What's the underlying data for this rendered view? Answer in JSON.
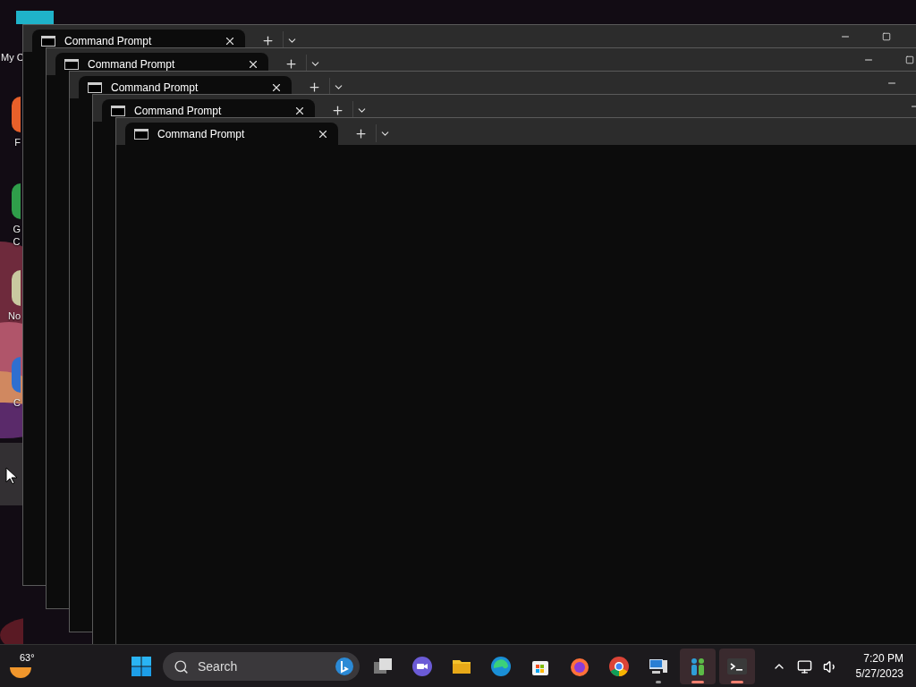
{
  "desktop": {
    "icons": [
      {
        "lines": [
          "My C"
        ],
        "kind": "folder"
      },
      {
        "lines": [
          "F"
        ],
        "kind": "firefox"
      },
      {
        "lines": [
          "G",
          "C"
        ],
        "kind": "chrome"
      },
      {
        "lines": [
          "No"
        ],
        "kind": "notepad"
      },
      {
        "lines": [
          "C"
        ],
        "kind": "computer"
      }
    ]
  },
  "windows": [
    {
      "tab": {
        "title": "Command Prompt"
      },
      "controls": [
        {
          "kind": "minimize"
        },
        {
          "kind": "maximize"
        }
      ]
    },
    {
      "tab": {
        "title": "Command Prompt"
      },
      "controls": [
        {
          "kind": "minimize"
        },
        {
          "kind": "maximize"
        }
      ]
    },
    {
      "tab": {
        "title": "Command Prompt"
      },
      "controls": [
        {
          "kind": "minimize"
        }
      ]
    },
    {
      "tab": {
        "title": "Command Prompt"
      },
      "controls": [
        {
          "kind": "minimize"
        }
      ]
    },
    {
      "tab": {
        "title": "Command Prompt"
      }
    }
  ],
  "taskbar": {
    "weather": {
      "temperature": "63°"
    },
    "search": {
      "placeholder": "Search"
    },
    "apps": [
      {
        "kind": "taskview",
        "running": false,
        "selected": false
      },
      {
        "kind": "chat",
        "running": false,
        "selected": false
      },
      {
        "kind": "explorer",
        "running": false,
        "selected": false
      },
      {
        "kind": "edge",
        "running": false,
        "selected": false
      },
      {
        "kind": "store",
        "running": false,
        "selected": false
      },
      {
        "kind": "firefox",
        "running": false,
        "selected": false
      },
      {
        "kind": "chrome",
        "running": false,
        "selected": false
      },
      {
        "kind": "computer",
        "running": true,
        "selected": false
      },
      {
        "kind": "people",
        "running": true,
        "selected": true
      },
      {
        "kind": "terminal",
        "running": true,
        "selected": true
      }
    ],
    "clock": {
      "time": "7:20 PM",
      "date": "5/27/2023"
    }
  }
}
